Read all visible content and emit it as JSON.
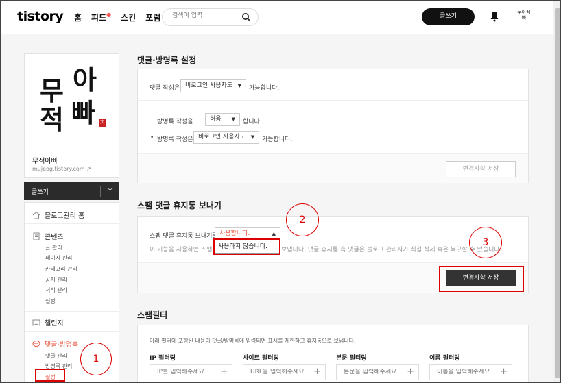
{
  "header": {
    "logo": "tistory",
    "nav": [
      {
        "label": "홈"
      },
      {
        "label": "피드"
      },
      {
        "label": "스킨"
      },
      {
        "label": "포럼"
      }
    ],
    "search_placeholder": "검색어 입력",
    "write_button": "글쓰기",
    "avatar_text": "무아적빠"
  },
  "sidebar": {
    "profile_image_text": [
      "무",
      "아",
      "적",
      "빠"
    ],
    "seal_text": "文",
    "blog_name": "무적아빠",
    "blog_url": "mujeog.tistory.com",
    "write_button": "글쓰기",
    "menu": {
      "blog_home": "블로그관리 홈",
      "contents": "콘텐츠",
      "contents_sub": [
        "글 관리",
        "페이지 관리",
        "카테고리 관리",
        "공지 관리",
        "서식 관리",
        "설정"
      ],
      "challenge": "챌린지",
      "comments": "댓글·방명록",
      "comments_sub": [
        "댓글 관리",
        "방명록 관리",
        "설정"
      ]
    }
  },
  "main": {
    "sec1": {
      "title": "댓글·방명록 설정",
      "comment_label": "댓글 작성은",
      "comment_select": "비로그인 사용자도",
      "comment_suffix": "가능합니다.",
      "guestbook_label": "방명록 작성을",
      "guestbook_select": "허용",
      "guestbook_suffix": "합니다.",
      "guestbook_write_label": "방명록 작성은",
      "guestbook_write_select": "비로그인 사용자도",
      "guestbook_write_suffix": "가능합니다.",
      "save_button": "변경사항 저장"
    },
    "sec2": {
      "title": "스팸 댓글 휴지통 보내기",
      "label": "스팸 댓글 휴지통 보내기를",
      "select_value": "사용합니다.",
      "dropdown_option": "사용하지 않습니다.",
      "desc_prefix": "이 기능을 사용하면 스팸 댓글",
      "desc_suffix": "보냅니다. 댓글 휴지통 속 댓글은 블로그 관리자가 직접 삭제 혹은 복구할 수 있습니다.",
      "save_button": "변경사항 저장"
    },
    "sec3": {
      "title": "스팸필터",
      "desc": "아래 필터에 포함된 내용이 댓글/방명록에 입력되면 표시를 제한하고 휴지통으로 보냅니다.",
      "filters": [
        {
          "label": "IP 필터링",
          "placeholder": "IP를 입력해주세요"
        },
        {
          "label": "사이트 필터링",
          "placeholder": "URL을 입력해주세요"
        },
        {
          "label": "본문 필터링",
          "placeholder": "본문을 입력해주세요"
        },
        {
          "label": "이름 필터링",
          "placeholder": "이름을 입력해주세요"
        }
      ]
    }
  },
  "annotations": [
    "1",
    "2",
    "3"
  ],
  "colors": {
    "accent_red": "#e8503a",
    "annotation_red": "#dd0000",
    "dark": "#333333"
  }
}
